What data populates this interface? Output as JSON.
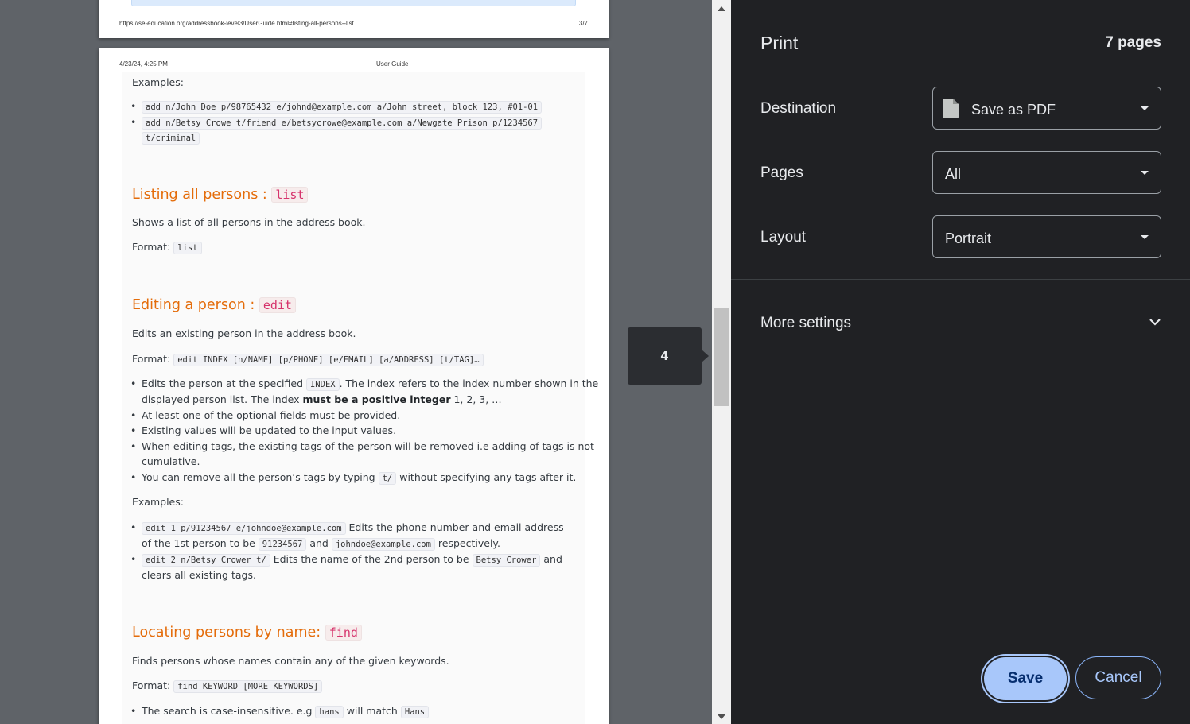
{
  "preview": {
    "prev_page": {
      "footer_url": "https://se-education.org/addressbook-level3/UserGuide.html#listing-all-persons--list",
      "footer_page": "3/7"
    },
    "cur_page": {
      "header_date": "4/23/24, 4:25 PM",
      "header_title": "User Guide"
    },
    "content": {
      "examples_label_1": "Examples:",
      "add_example_1": "add n/John Doe p/98765432 e/johnd@example.com a/John street, block 123, #01-01",
      "add_example_2a": "add n/Betsy Crowe t/friend e/betsycrowe@example.com a/Newgate Prison p/1234567",
      "add_example_2b": "t/criminal",
      "list_heading": "Listing all persons : ",
      "list_heading_code": "list",
      "list_desc": "Shows a list of all persons in the address book.",
      "list_format_label": "Format: ",
      "list_format_code": "list",
      "edit_heading": "Editing a person : ",
      "edit_heading_code": "edit",
      "edit_desc": "Edits an existing person in the address book.",
      "edit_format_label": "Format: ",
      "edit_format_code": "edit INDEX [n/NAME] [p/PHONE] [e/EMAIL] [a/ADDRESS] [t/TAG]…",
      "edit_b1_pre": "Edits the person at the specified ",
      "edit_b1_code": "INDEX",
      "edit_b1_post": ". The index refers to the index number shown in the",
      "edit_b1_line2_pre": "displayed person list. The index ",
      "edit_b1_bold": "must be a positive integer",
      "edit_b1_line2_post": " 1, 2, 3, …",
      "edit_b2": "At least one of the optional fields must be provided.",
      "edit_b3": "Existing values will be updated to the input values.",
      "edit_b4a": "When editing tags, the existing tags of the person will be removed i.e adding of tags is not",
      "edit_b4b": "cumulative.",
      "edit_b5_pre": "You can remove all the person’s tags by typing ",
      "edit_b5_code": "t/",
      "edit_b5_post": " without specifying any tags after it.",
      "examples_label_2": "Examples:",
      "edit_ex1_code": "edit 1 p/91234567 e/johndoe@example.com",
      "edit_ex1_post": " Edits the phone number and email address",
      "edit_ex1_line2_pre": "of the 1st person to be ",
      "edit_ex1_code2": "91234567",
      "edit_ex1_and": " and ",
      "edit_ex1_code3": "johndoe@example.com",
      "edit_ex1_end": " respectively.",
      "edit_ex2_code": "edit 2 n/Betsy Crower t/",
      "edit_ex2_post": " Edits the name of the 2nd person to be ",
      "edit_ex2_code2": "Betsy Crower",
      "edit_ex2_end": " and",
      "edit_ex2_line2": "clears all existing tags.",
      "find_heading": "Locating persons by name: ",
      "find_heading_code": "find",
      "find_desc": "Finds persons whose names contain any of the given keywords.",
      "find_format_label": "Format: ",
      "find_format_code": "find KEYWORD [MORE_KEYWORDS]",
      "find_b1_pre": "The search is case-insensitive. e.g ",
      "find_b1_code": "hans",
      "find_b1_mid": " will match ",
      "find_b1_code2": "Hans"
    }
  },
  "tooltip": {
    "page_number": "4"
  },
  "sidebar": {
    "title": "Print",
    "page_count": "7 pages",
    "destination": {
      "label": "Destination",
      "value": "Save as PDF"
    },
    "pages": {
      "label": "Pages",
      "value": "All"
    },
    "layout": {
      "label": "Layout",
      "value": "Portrait"
    },
    "more_settings": "More settings",
    "save": "Save",
    "cancel": "Cancel"
  },
  "colors": {
    "sidebar_bg": "#202124",
    "accent": "#a8c7fa",
    "heading_orange": "#e46c0a"
  }
}
